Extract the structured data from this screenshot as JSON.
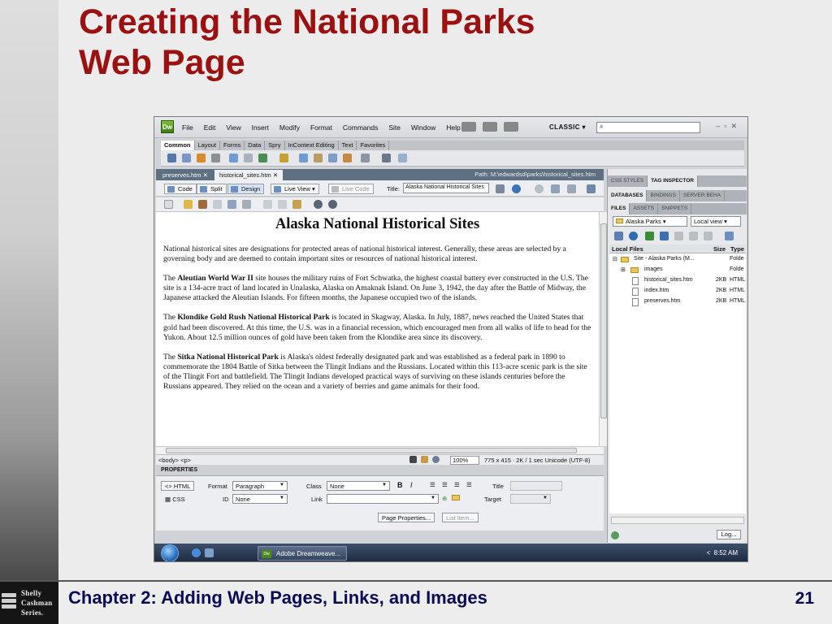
{
  "slide": {
    "title_line1": "Creating the National Parks",
    "title_line2": "Web Page",
    "footer_chapter": "Chapter 2: Adding Web Pages, Links, and Images",
    "page_number": "21",
    "logo_lines": [
      "Shelly",
      "Cashman",
      "Series."
    ]
  },
  "app": {
    "logo": "Dw",
    "menu": [
      "File",
      "Edit",
      "View",
      "Insert",
      "Modify",
      "Format",
      "Commands",
      "Site",
      "Window",
      "Help"
    ],
    "workspace": "CLASSIC",
    "insert_tabs": [
      "Common",
      "Layout",
      "Forms",
      "Data",
      "Spry",
      "InContext Editing",
      "Text",
      "Favorites"
    ],
    "doc_tabs": [
      "preserves.htm",
      "historical_sites.htm"
    ],
    "path": "Path:  M:\\edwardsd\\parks\\historical_sites.htm",
    "view_buttons": [
      "Code",
      "Split",
      "Design",
      "Live View",
      "Live Code"
    ],
    "title_label": "Title:",
    "title_value": "Alaska National Historical Sites"
  },
  "document": {
    "heading": "Alaska National Historical Sites",
    "p1": "National historical sites are designations for protected areas of national historical interest. Generally, these areas are selected by a governing body and are deemed to contain important sites or resources of national historical interest.",
    "p2_pre": "The ",
    "p2_bold": "Aleutian World War II",
    "p2_post": " site houses the military ruins of Fort Schwatka, the highest coastal battery ever constructed in the U.S. The site is a 134-acre tract of land located in Unalaska, Alaska on Amaknak Island. On June 3, 1942, the day after the Battle of Midway, the Japanese attacked the Aleutian Islands. For fifteen months, the Japanese occupied two of the islands.",
    "p3_pre": "The ",
    "p3_bold": "Klondike Gold Rush National Historical Park",
    "p3_post": " is located in Skagway, Alaska. In July, 1887, news reached the United States that gold had been discovered. At this time, the U.S. was in a financial recession, which encouraged men from all walks of life to head for the Yukon.  About 12.5 million ounces of gold have been taken from the Klondike area since its discovery.",
    "p4_pre": "The ",
    "p4_bold": "Sitka National Historical Park",
    "p4_post": " is Alaska's oldest federally designated park and was established as a federal park in 1890 to commemorate the 1804 Battle of Sitka between the Tlingit Indians and the Russians. Located within this 113-acre scenic park is the site of the Tlingit Fort and battlefield. The Tlingit Indians developed practical ways of surviving on these islands centuries before the Russians appeared. They relied on the ocean and a variety of berries and game animals for their food."
  },
  "status": {
    "tag_selector": "<body> <p>",
    "zoom": "100%",
    "info": "775 x 415 ∙  2K / 1 sec  Unicode (UTF-8)"
  },
  "properties": {
    "header": "PROPERTIES",
    "html_btn": "HTML",
    "css_btn": "CSS",
    "format_label": "Format",
    "format_value": "Paragraph",
    "class_label": "Class",
    "class_value": "None",
    "id_label": "ID",
    "id_value": "None",
    "link_label": "Link",
    "title_label": "Title",
    "target_label": "Target",
    "page_props_btn": "Page Properties...",
    "list_item_btn": "List Item..."
  },
  "panels": {
    "tabs1": [
      "CSS STYLES",
      "TAG INSPECTOR"
    ],
    "tabs2": [
      "DATABASES",
      "BINDINGS",
      "SERVER BEHA"
    ],
    "tabs3": [
      "FILES",
      "ASSETS",
      "SNIPPETS"
    ],
    "site_select": "Alaska Parks",
    "view_select": "Local view",
    "col_local": "Local Files",
    "col_size": "Size",
    "col_type": "Type",
    "files": [
      {
        "name": "Site - Alaska Parks (M...",
        "size": "",
        "type": "Folde"
      },
      {
        "name": "images",
        "size": "",
        "type": "Folde"
      },
      {
        "name": "historical_sites.htm",
        "size": "2KB",
        "type": "HTML"
      },
      {
        "name": "index.htm",
        "size": "2KB",
        "type": "HTML"
      },
      {
        "name": "preserves.htm",
        "size": "2KB",
        "type": "HTML"
      }
    ],
    "log_btn": "Log..."
  },
  "taskbar": {
    "item": "Adobe Dreamweave...",
    "clock": "8:52 AM"
  },
  "colors": {
    "title": "#9b1111",
    "footer_text": "#0b0b55"
  }
}
